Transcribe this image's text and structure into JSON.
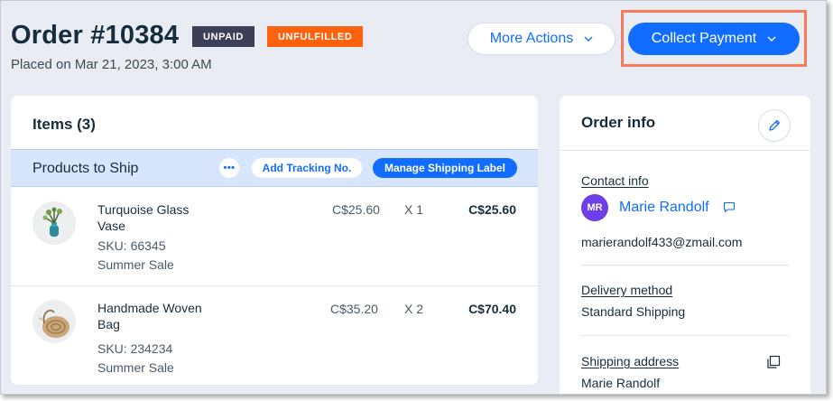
{
  "header": {
    "order_title": "Order #10384",
    "placed_on": "Placed on Mar 21, 2023, 3:00 AM",
    "badges": {
      "payment": "UNPAID",
      "fulfillment": "UNFULFILLED"
    },
    "more_actions_label": "More Actions",
    "collect_payment_label": "Collect Payment"
  },
  "items_card": {
    "title": "Items (3)",
    "shipping_section": {
      "label": "Products to Ship",
      "more_glyph": "•••",
      "add_tracking_label": "Add Tracking No.",
      "manage_label_label": "Manage Shipping Label"
    },
    "items": [
      {
        "name": "Turquoise Glass Vase",
        "sku": "SKU: 66345",
        "tag": "Summer Sale",
        "price": "C$25.60",
        "qty": "X 1",
        "total": "C$25.60"
      },
      {
        "name": "Handmade Woven Bag",
        "sku": "SKU: 234234",
        "tag": "Summer Sale",
        "price": "C$35.20",
        "qty": "X 2",
        "total": "C$70.40"
      }
    ]
  },
  "info_card": {
    "title": "Order info",
    "contact_label": "Contact info",
    "avatar_initials": "MR",
    "contact_name": "Marie Randolf",
    "contact_email": "marierandolf433@zmail.com",
    "delivery_label": "Delivery method",
    "delivery_value": "Standard Shipping",
    "shipping_label": "Shipping address",
    "shipping_name": "Marie Randolf"
  },
  "colors": {
    "accent": "#116dff",
    "unpaid_badge": "#3b4057",
    "unfulfilled_badge": "#fe620f",
    "avatar": "#6e3ee8",
    "highlight_box": "#f47c5b"
  },
  "icons": [
    "chevron-down-icon",
    "more-dots-icon",
    "pencil-icon",
    "chat-bubble-icon",
    "copy-icon"
  ]
}
